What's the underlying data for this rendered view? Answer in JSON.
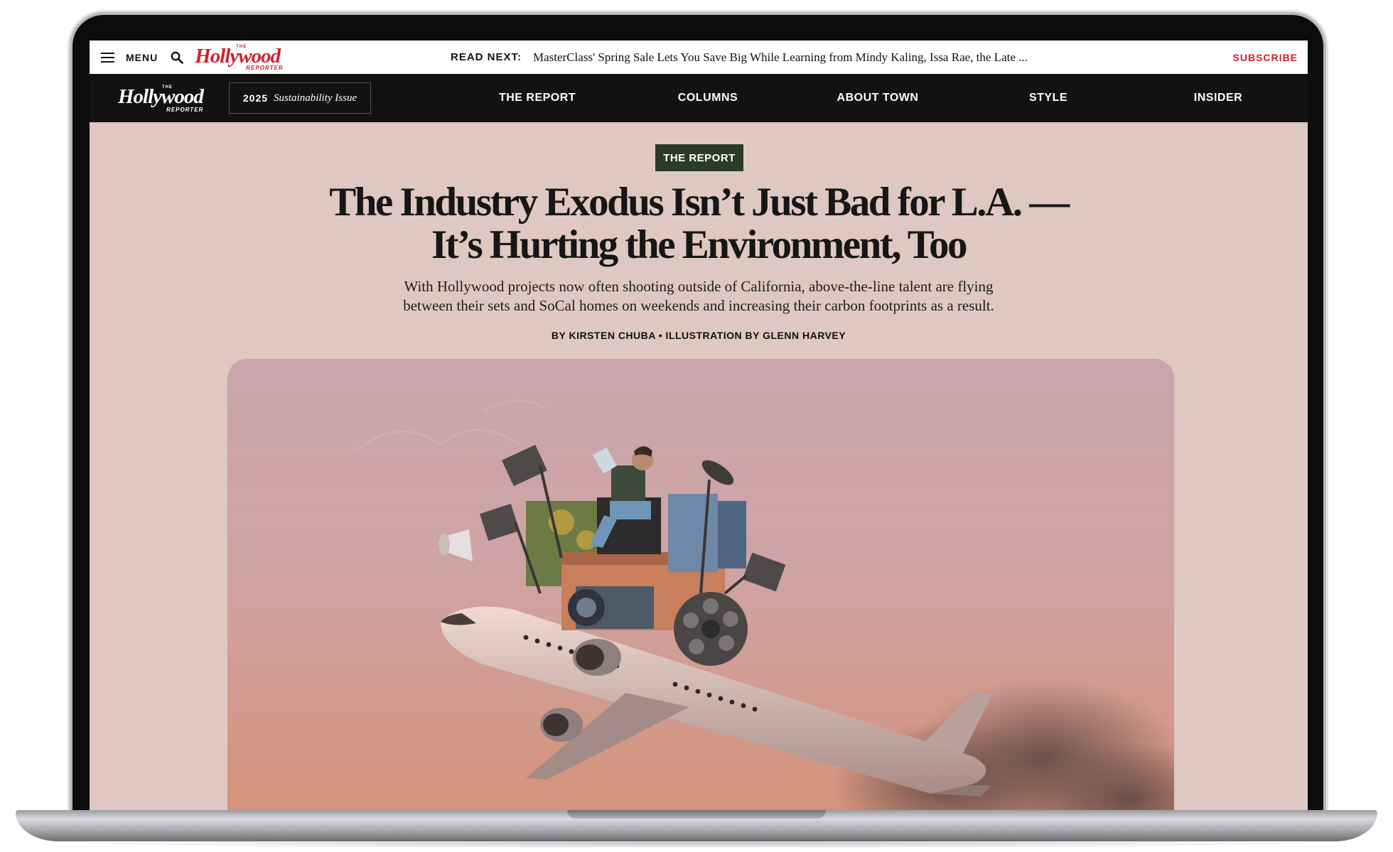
{
  "topbar": {
    "menu_label": "MENU",
    "logo_word": "Hollywood",
    "logo_the": "THE",
    "logo_reporter": "REPORTER",
    "read_next_label": "READ NEXT:",
    "read_next_title": "MasterClass' Spring Sale Lets You Save Big While Learning from Mindy Kaling, Issa Rae, the Late ...",
    "subscribe_label": "SUBSCRIBE"
  },
  "navbar": {
    "logo_word": "Hollywood",
    "logo_the": "THE",
    "logo_reporter": "REPORTER",
    "issue_year": "2025",
    "issue_name": "Sustainability Issue",
    "items": [
      {
        "label": "THE REPORT"
      },
      {
        "label": "COLUMNS"
      },
      {
        "label": "ABOUT TOWN"
      },
      {
        "label": "STYLE"
      },
      {
        "label": "INSIDER"
      }
    ]
  },
  "article": {
    "category": "THE REPORT",
    "headline_line1": "The Industry Exodus Isn’t Just Bad for L.A. —",
    "headline_line2": "It’s Hurting the Environment, Too",
    "dek_line1": "With Hollywood projects now often shooting outside of California, above-the-line talent are flying",
    "dek_line2": "between their sets and SoCal homes on weekends and increasing their carbon footprints as a result.",
    "byline": "BY KIRSTEN CHUBA • ILLUSTRATION BY GLENN HARVEY"
  },
  "colors": {
    "page_bg": "#dec8c1",
    "brand_red": "#d0202b",
    "nav_bg": "#121212",
    "badge_green": "#2b3b2a",
    "hero_top": "#c9a5ad",
    "hero_bottom": "#d4907a"
  },
  "icons": [
    "hamburger-icon",
    "search-icon"
  ]
}
